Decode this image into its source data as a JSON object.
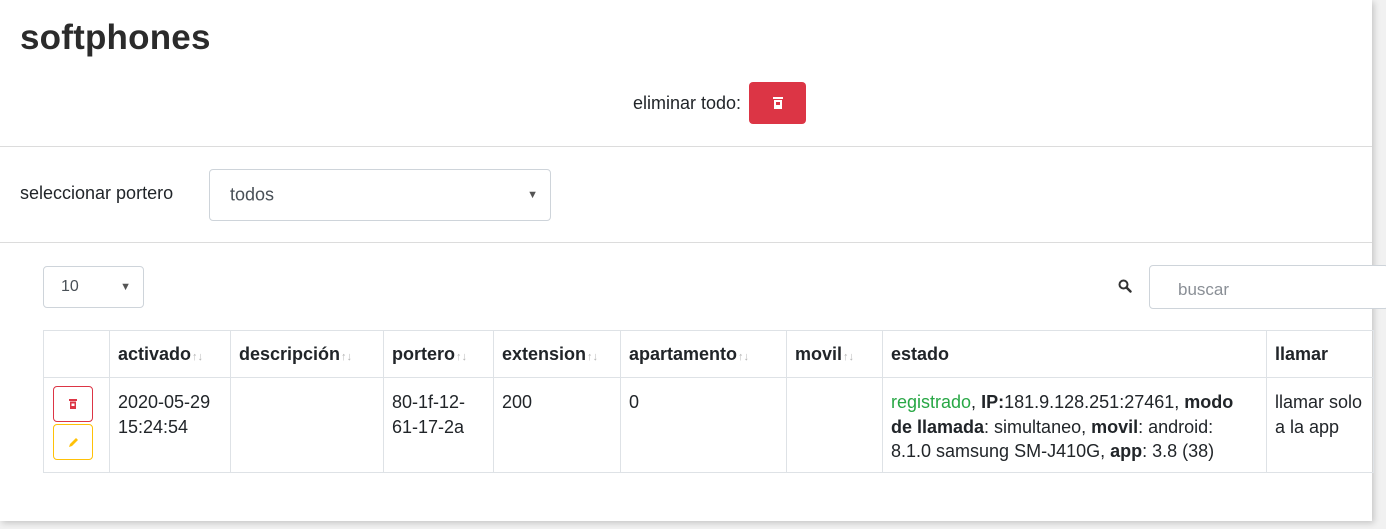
{
  "page": {
    "title": "softphones"
  },
  "delete_all": {
    "label": "eliminar todo:"
  },
  "portero_filter": {
    "label": "seleccionar portero",
    "value": "todos"
  },
  "table_controls": {
    "page_size": "10",
    "search_placeholder": "buscar"
  },
  "table": {
    "columns": [
      "activado",
      "descripción",
      "portero",
      "extension",
      "apartamento",
      "movil",
      "estado",
      "llamar"
    ],
    "sort_indicator": "↑↓",
    "rows": [
      {
        "activado": "2020-05-29 15:24:54",
        "descripcion": "",
        "portero": "80-1f-12-61-17-2a",
        "extension": "200",
        "apartamento": "0",
        "movil": "",
        "estado": {
          "status": "registrado",
          "sep1": ", ",
          "ip_label": "IP:",
          "ip_value": "181.9.128.251:27461,",
          "mode_label": "modo de llamada",
          "mode_value": ": simultaneo, ",
          "movil_label": "movil",
          "movil_value": ": android: 8.1.0 samsung SM-J410G, ",
          "app_label": "app",
          "app_value": ": 3.8 (38)"
        },
        "llamar": "llamar solo a la app"
      }
    ]
  },
  "colors": {
    "danger": "#dc3545",
    "warning": "#ffc107",
    "success": "#28a745"
  },
  "icons": [
    "trash-icon",
    "pencil-icon",
    "search-icon",
    "caret-down-icon"
  ]
}
